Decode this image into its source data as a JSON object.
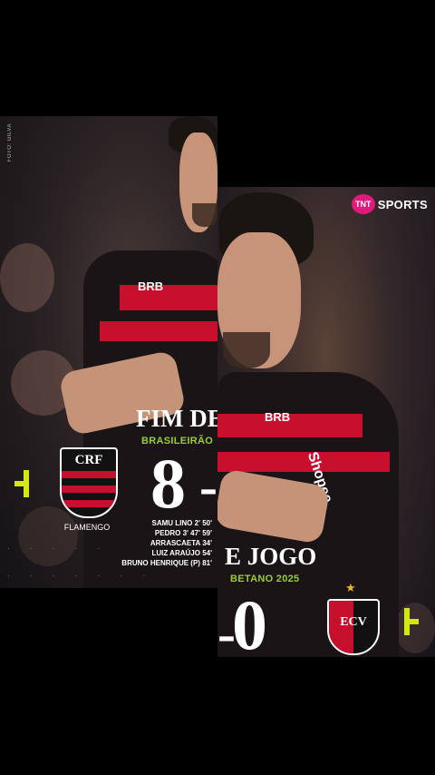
{
  "photo_credit": "FOTO: GILVA",
  "broadcaster": {
    "badge": "TNT",
    "word": "SPORTS"
  },
  "headline_left": "FIM DE",
  "headline_right": "E JOGO",
  "competition_left": "BRASILEIRÃO",
  "competition_right": "BETANO 2025",
  "home_score": "8",
  "away_score": "0",
  "score_dash_left": "-",
  "score_dash_right": "-",
  "home_team": {
    "name": "FLAMENGO",
    "crest_text": "CRF"
  },
  "away_team": {
    "crest_text": "ECV"
  },
  "jersey_sponsor": "BRB",
  "jersey_sponsor_right": "Shopee",
  "scorers": [
    "SAMU LINO 2' 50'",
    "PEDRO 3' 47' 59'",
    "ARRASCAETA 34'",
    "LUIZ ARAÚJO 54'",
    "BRUNO HENRIQUE (P) 81'"
  ],
  "colors": {
    "accent": "#d4e80f",
    "competition": "#9acd32",
    "flamengo_red": "#c8102e",
    "tnt_pink": "#e0197a"
  }
}
